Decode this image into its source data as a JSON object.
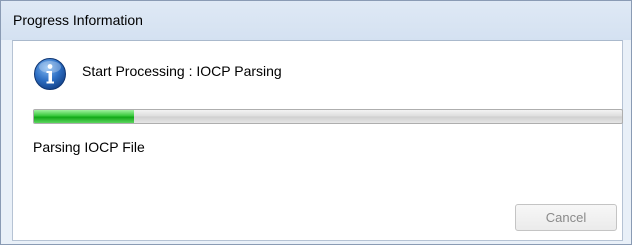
{
  "window": {
    "title": "Progress Information"
  },
  "dialog": {
    "icon": "info-icon",
    "message": "Start Processing : IOCP Parsing",
    "progress": 0.17,
    "status": "Parsing IOCP File",
    "cancel_label": "Cancel",
    "cancel_enabled": false
  },
  "colors": {
    "progress_fill": "#22b52a",
    "icon_blue": "#1f5fb4"
  }
}
